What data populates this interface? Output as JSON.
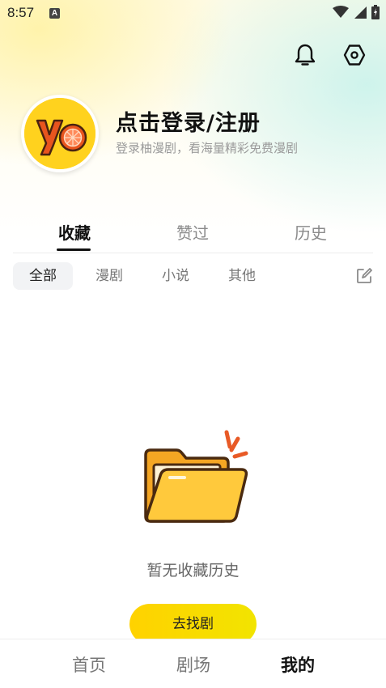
{
  "status": {
    "time": "8:57",
    "a_badge": "A"
  },
  "profile": {
    "title": "点击登录/注册",
    "subtitle": "登录柚漫剧，看海量精彩免费漫剧",
    "avatar_logo_text": "yo"
  },
  "tabs": [
    {
      "label": "收藏",
      "active": true
    },
    {
      "label": "赞过",
      "active": false
    },
    {
      "label": "历史",
      "active": false
    }
  ],
  "filters": [
    {
      "label": "全部",
      "active": true
    },
    {
      "label": "漫剧",
      "active": false
    },
    {
      "label": "小说",
      "active": false
    },
    {
      "label": "其他",
      "active": false
    }
  ],
  "empty": {
    "message": "暂无收藏历史",
    "cta_label": "去找剧"
  },
  "bottom_nav": [
    {
      "label": "首页",
      "active": false
    },
    {
      "label": "剧场",
      "active": false
    },
    {
      "label": "我的",
      "active": true
    }
  ],
  "icons": {
    "top_right": [
      "bell-icon",
      "settings-icon"
    ],
    "filter_edit": "edit-icon",
    "empty_state": "folder-icon"
  },
  "colors": {
    "accent": "#ffd200",
    "avatar_bg": "#ffd21e"
  }
}
